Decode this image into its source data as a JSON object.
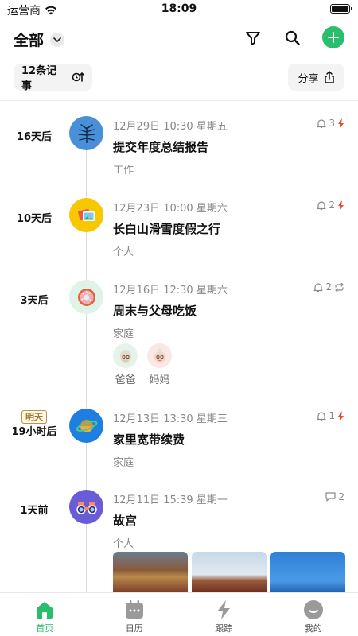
{
  "status_bar": {
    "carrier": "运营商",
    "time": "18:09"
  },
  "header": {
    "title": "全部"
  },
  "actions": {
    "count_label": "12条记事",
    "share_label": "分享"
  },
  "events": [
    {
      "relative": "16天后",
      "tag": "",
      "date": "12月29日 10:30 星期五",
      "title": "提交年度总结报告",
      "category": "工作",
      "badge_count": "3",
      "badge_type": "bell",
      "urgent": true,
      "avatar_color": "#4a90d9",
      "avatar_icon": "leaf-icon"
    },
    {
      "relative": "10天后",
      "tag": "",
      "date": "12月23日 10:00 星期六",
      "title": "长白山滑雪度假之行",
      "category": "个人",
      "badge_count": "2",
      "badge_type": "bell",
      "urgent": true,
      "avatar_color": "#f7c800",
      "avatar_icon": "photos-icon"
    },
    {
      "relative": "3天后",
      "tag": "",
      "date": "12月16日 12:30 星期六",
      "title": "周末与父母吃饭",
      "category": "家庭",
      "badge_count": "2",
      "badge_type": "bell",
      "repeat": true,
      "avatar_color": "#dff3e6",
      "avatar_icon": "donut-icon",
      "people": [
        {
          "name": "爸爸"
        },
        {
          "name": "妈妈"
        }
      ]
    },
    {
      "relative": "19小时后",
      "tag": "明天",
      "date": "12月13日 13:30 星期三",
      "title": "家里宽带续费",
      "category": "家庭",
      "badge_count": "1",
      "badge_type": "bell",
      "urgent": true,
      "avatar_color": "#1f7fe0",
      "avatar_icon": "planet-icon"
    },
    {
      "relative": "1天前",
      "tag": "",
      "date": "12月11日 15:39 星期一",
      "title": "故宫",
      "category": "个人",
      "badge_count": "2",
      "badge_type": "comment",
      "avatar_color": "#6a5bd6",
      "avatar_icon": "binoculars-icon"
    }
  ],
  "tabs": [
    {
      "label": "首页",
      "icon": "home-icon"
    },
    {
      "label": "日历",
      "icon": "calendar-icon"
    },
    {
      "label": "跟踪",
      "icon": "bolt-icon"
    },
    {
      "label": "我的",
      "icon": "profile-icon"
    }
  ],
  "colors": {
    "accent": "#2bbd6e",
    "urgent": "#e8473b"
  }
}
